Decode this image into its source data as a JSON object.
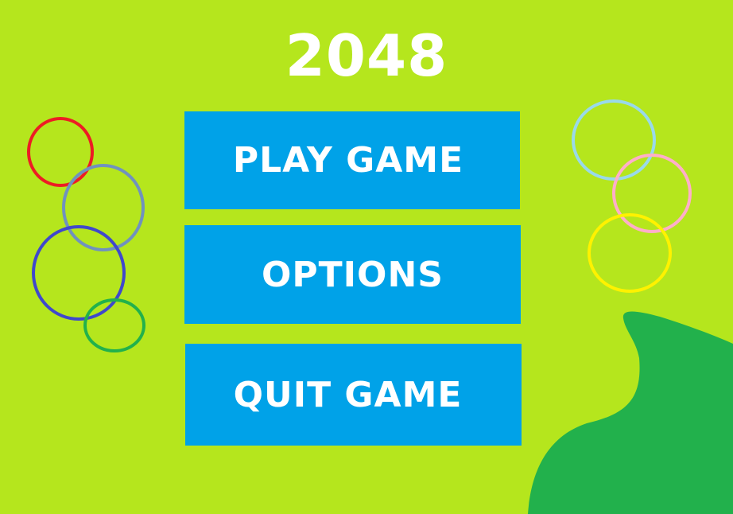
{
  "game": {
    "title": "2048"
  },
  "menu": {
    "play_label": "PLAY GAME",
    "options_label": "OPTIONS",
    "quit_label": "QUIT GAME"
  },
  "colors": {
    "background": "#b5e61d",
    "button": "#00a2e8",
    "text": "#ffffff",
    "blob": "#22b14c",
    "ring_red": "#ed1c24",
    "ring_slate": "#7092be",
    "ring_indigo": "#3f48cc",
    "ring_green": "#22b14c",
    "ring_light_blue": "#99d9ea",
    "ring_pink": "#ffaec9",
    "ring_yellow": "#fff200"
  }
}
